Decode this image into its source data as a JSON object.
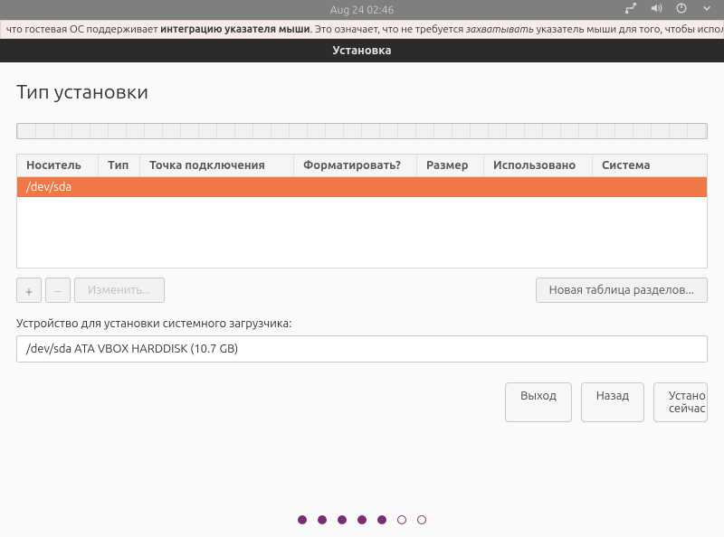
{
  "topbar": {
    "clock": "Aug 24  02:46"
  },
  "vbox_note": {
    "pre": "что гостевая ОС поддерживает ",
    "bold": "интеграцию указателя мыши",
    "mid": ". Это означает, что не требуется ",
    "ital": "захватывать",
    "post": " указатель мыши для того, чтобы использо"
  },
  "window": {
    "title": "Установка"
  },
  "page": {
    "title": "Тип установки"
  },
  "table": {
    "headers": {
      "device": "Носитель",
      "type": "Тип",
      "mount": "Точка подключения",
      "format": "Форматировать?",
      "size": "Размер",
      "used": "Использовано",
      "system": "Система"
    },
    "rows": [
      {
        "device": "/dev/sda",
        "type": "",
        "mount": "",
        "format": "",
        "size": "",
        "used": "",
        "system": ""
      }
    ]
  },
  "buttons": {
    "add": "+",
    "remove": "−",
    "change": "Изменить...",
    "new_table": "Новая таблица разделов..."
  },
  "bootloader": {
    "label": "Устройство для установки системного загрузчика:",
    "value": "/dev/sda ATA VBOX HARDDISK (10.7 GB)"
  },
  "nav": {
    "quit": "Выход",
    "back": "Назад",
    "install": "Установить сейчас"
  },
  "progress": {
    "total": 7,
    "current": 6
  }
}
